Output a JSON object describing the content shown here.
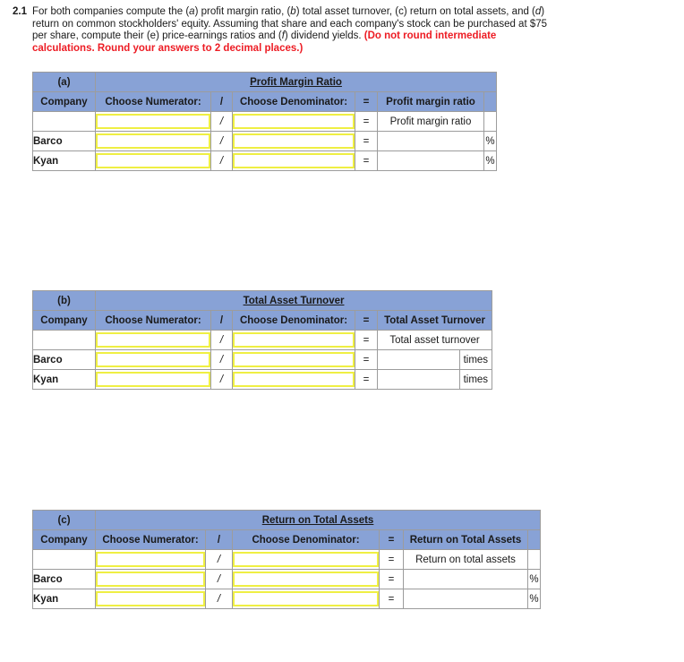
{
  "question": {
    "number": "2.1",
    "line1_pre": "For both companies compute the (",
    "text_full": "For both companies compute the (a) profit margin ratio, (b) total asset turnover, (c) return on total assets, and (d) return on common stockholders' equity. Assuming that share and each company's stock can be purchased at $75 per share, compute their (e) price-earnings ratios and (f) dividend yields.",
    "emphasis": "(Do not round intermediate calculations. Round your answers to 2 decimal places.)",
    "segments": [
      {
        "t": "For both companies compute the (",
        "style": "normal"
      },
      {
        "t": "a",
        "style": "italic"
      },
      {
        "t": ") profit margin ratio, (",
        "style": "normal"
      },
      {
        "t": "b",
        "style": "italic"
      },
      {
        "t": ") total asset turnover, (c) return on total assets, and (",
        "style": "normal"
      },
      {
        "t": "d",
        "style": "italic"
      },
      {
        "t": ") return on common stockholders' equity. Assuming that share and each company's stock can be purchased at $75 per share, compute their (e) price-earnings ratios and (",
        "style": "normal"
      },
      {
        "t": "f",
        "style": "italic"
      },
      {
        "t": ") dividend yields. ",
        "style": "normal"
      },
      {
        "t": "(Do not round intermediate calculations. Round your answers to 2 decimal places.)",
        "style": "emph"
      }
    ]
  },
  "colors": {
    "header_blue": "#88a2d6",
    "input_yellow": "#efef43",
    "grid_gray": "#9c9c9c",
    "emphasis_red": "#ed1c24",
    "text": "#1a1a1a"
  },
  "tables": [
    {
      "part_label": "(a)",
      "title": "Profit Margin Ratio",
      "columns": {
        "company": "Company",
        "numerator": "Choose Numerator:",
        "slash": "/",
        "denominator": "Choose Denominator:",
        "equals": "=",
        "result": "Profit margin ratio"
      },
      "result_caption": "Profit margin ratio",
      "unit": "%",
      "rows": [
        {
          "company": "",
          "numerator": "",
          "slash": "/",
          "denominator": "",
          "equals": "=",
          "result": "",
          "unit": ""
        },
        {
          "company": "Barco",
          "numerator": "",
          "slash": "/",
          "denominator": "",
          "equals": "=",
          "result": "",
          "unit": "%"
        },
        {
          "company": "Kyan",
          "numerator": "",
          "slash": "/",
          "denominator": "",
          "equals": "=",
          "result": "",
          "unit": "%"
        }
      ]
    },
    {
      "part_label": "(b)",
      "title": "Total Asset Turnover",
      "columns": {
        "company": "Company",
        "numerator": "Choose Numerator:",
        "slash": "/",
        "denominator": "Choose Denominator:",
        "equals": "=",
        "result": "Total Asset Turnover"
      },
      "result_caption": "Total asset turnover",
      "unit": "times",
      "rows": [
        {
          "company": "",
          "numerator": "",
          "slash": "/",
          "denominator": "",
          "equals": "=",
          "result": "",
          "unit": ""
        },
        {
          "company": "Barco",
          "numerator": "",
          "slash": "/",
          "denominator": "",
          "equals": "=",
          "result": "",
          "unit": "times"
        },
        {
          "company": "Kyan",
          "numerator": "",
          "slash": "/",
          "denominator": "",
          "equals": "=",
          "result": "",
          "unit": "times"
        }
      ]
    },
    {
      "part_label": "(c)",
      "title": "Return on Total Assets",
      "columns": {
        "company": "Company",
        "numerator": "Choose Numerator:",
        "slash": "/",
        "denominator": "Choose Denominator:",
        "equals": "=",
        "result": "Return on Total Assets"
      },
      "result_caption": "Return on total assets",
      "unit": "%",
      "rows": [
        {
          "company": "",
          "numerator": "",
          "slash": "/",
          "denominator": "",
          "equals": "=",
          "result": "",
          "unit": ""
        },
        {
          "company": "Barco",
          "numerator": "",
          "slash": "/",
          "denominator": "",
          "equals": "=",
          "result": "",
          "unit": "%"
        },
        {
          "company": "Kyan",
          "numerator": "",
          "slash": "/",
          "denominator": "",
          "equals": "=",
          "result": "",
          "unit": "%"
        }
      ]
    }
  ]
}
